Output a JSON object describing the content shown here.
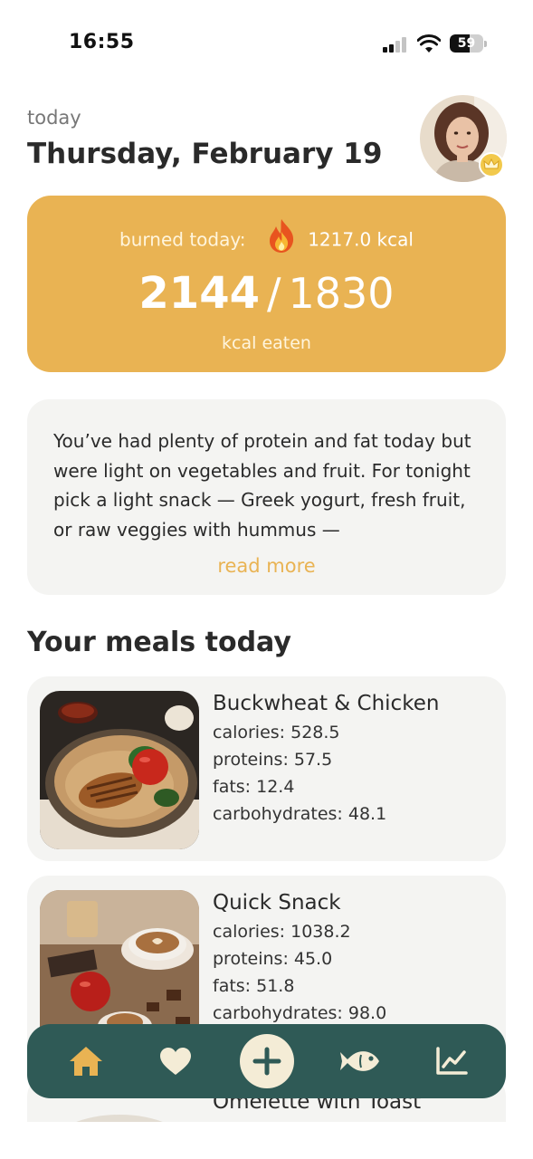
{
  "status_bar": {
    "time": "16:55",
    "battery": "59",
    "battery_level": 0.59
  },
  "header": {
    "today_label": "today",
    "date": "Thursday, February 19"
  },
  "calorie_card": {
    "burned_label": "burned today:",
    "burned_value": "1217.0 kcal",
    "eaten": "2144",
    "separator": "/",
    "goal": "1830",
    "eaten_label": "kcal eaten",
    "color": "#e9b353"
  },
  "advice": {
    "text": "You’ve had plenty of protein and fat today but were light on vegetables and fruit. For tonight pick a light snack — Greek yogurt, fresh fruit, or raw veggies with hummus —",
    "read_more": "read more"
  },
  "meals_section": {
    "title": "Your meals today"
  },
  "meals": [
    {
      "name": "Buckwheat & Chicken",
      "calories": "calories: 528.5",
      "proteins": "proteins: 57.5",
      "fats": "fats: 12.4",
      "carbohydrates": "carbohydrates: 48.1"
    },
    {
      "name": "Quick Snack",
      "calories": "calories: 1038.2",
      "proteins": "proteins: 45.0",
      "fats": "fats: 51.8",
      "carbohydrates": "carbohydrates: 98.0"
    },
    {
      "name": "Omelette with Toast"
    }
  ],
  "bottom_nav": {
    "items": [
      "home-icon",
      "heart-icon",
      "add-icon",
      "fish-icon",
      "chart-icon"
    ],
    "background": "#2f5a56",
    "active_color": "#e9b353",
    "icon_color": "#f4ecd6"
  }
}
